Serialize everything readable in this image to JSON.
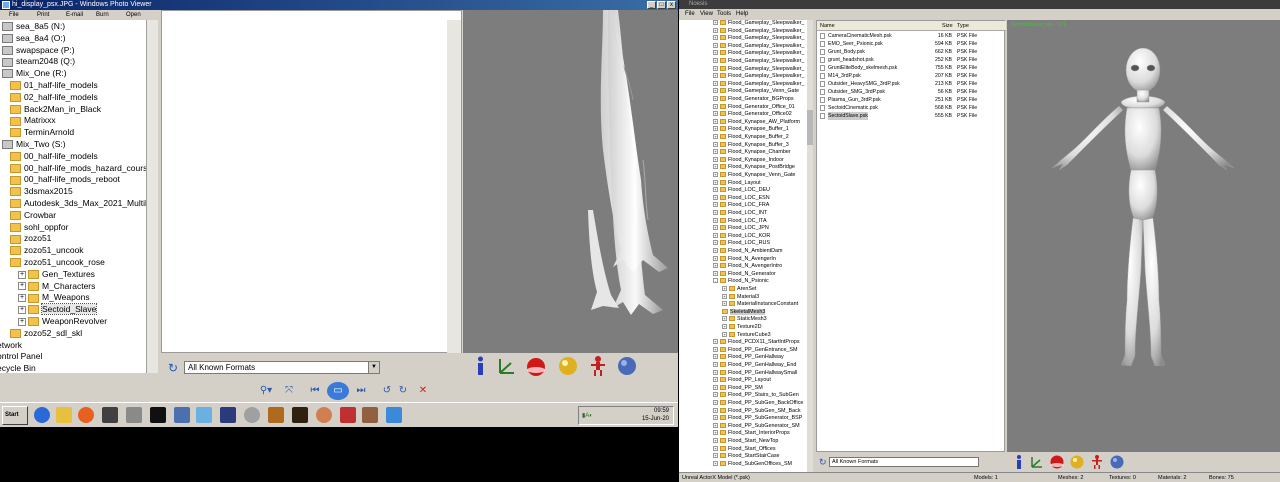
{
  "left_window": {
    "title": "hi_display_psx.JPG - Windows Photo Viewer",
    "menu": [
      "File",
      "Print",
      "E-mail",
      "Burn",
      "Open"
    ],
    "tree": [
      {
        "label": "sea_8a5 (N:)",
        "indent": 0,
        "type": "drive"
      },
      {
        "label": "sea_8a4 (O:)",
        "indent": 0,
        "type": "drive"
      },
      {
        "label": "swapspace (P:)",
        "indent": 0,
        "type": "drive"
      },
      {
        "label": "steam2048 (Q:)",
        "indent": 0,
        "type": "drive"
      },
      {
        "label": "Mix_One (R:)",
        "indent": 0,
        "type": "drive"
      },
      {
        "label": "01_half-life_models",
        "indent": 1,
        "type": "folder"
      },
      {
        "label": "02_half-life_models",
        "indent": 1,
        "type": "folder"
      },
      {
        "label": "Back2Man_in_Black",
        "indent": 1,
        "type": "folder"
      },
      {
        "label": "Matrixxx",
        "indent": 1,
        "type": "folder"
      },
      {
        "label": "TerminArnold",
        "indent": 1,
        "type": "folder"
      },
      {
        "label": "Mix_Two (S:)",
        "indent": 0,
        "type": "drive"
      },
      {
        "label": "00_half-life_models",
        "indent": 1,
        "type": "folder"
      },
      {
        "label": "00_half-life_mods_hazard_course",
        "indent": 1,
        "type": "folder"
      },
      {
        "label": "00_half-life_mods_reboot",
        "indent": 1,
        "type": "folder"
      },
      {
        "label": "3dsmax2015",
        "indent": 1,
        "type": "folder"
      },
      {
        "label": "Autodesk_3ds_Max_2021_Multilang",
        "indent": 1,
        "type": "folder"
      },
      {
        "label": "Crowbar",
        "indent": 1,
        "type": "folder"
      },
      {
        "label": "sohl_oppfor",
        "indent": 1,
        "type": "folder"
      },
      {
        "label": "zozo51",
        "indent": 1,
        "type": "folder"
      },
      {
        "label": "zozo51_uncook",
        "indent": 1,
        "type": "folder"
      },
      {
        "label": "zozo51_uncook_rose",
        "indent": 1,
        "type": "folder"
      },
      {
        "label": "Gen_Textures",
        "indent": 2,
        "type": "folder",
        "expandable": true
      },
      {
        "label": "M_Characters",
        "indent": 2,
        "type": "folder",
        "expandable": true
      },
      {
        "label": "M_Weapons",
        "indent": 2,
        "type": "folder",
        "expandable": true
      },
      {
        "label": "Sectoid_Slave",
        "indent": 2,
        "type": "folder",
        "expandable": true,
        "selected": true
      },
      {
        "label": "WeaponRevolver",
        "indent": 2,
        "type": "folder",
        "expandable": true
      },
      {
        "label": "zozo52_sdl_skl",
        "indent": 1,
        "type": "folder"
      },
      {
        "label": "etwork",
        "indent": -1,
        "type": "plain"
      },
      {
        "label": "ontrol Panel",
        "indent": -1,
        "type": "plain"
      },
      {
        "label": "ecycle Bin",
        "indent": -1,
        "type": "plain"
      }
    ],
    "filter": {
      "refresh_icon": "refresh-icon",
      "value": "All Known Formats"
    },
    "taskbar": {
      "start_label": "Start",
      "clock_time": "09:59",
      "clock_date": "15-Jun-20"
    }
  },
  "right_window": {
    "title": "Noesis",
    "menu": [
      "File",
      "View",
      "Tools",
      "Help"
    ],
    "packages": [
      {
        "label": "Flood_Gameplay_Sleepwalker_",
        "indent": 1,
        "expandable": true
      },
      {
        "label": "Flood_Gameplay_Sleepwalker_",
        "indent": 1,
        "expandable": true
      },
      {
        "label": "Flood_Gameplay_Sleepwalker_",
        "indent": 1,
        "expandable": true
      },
      {
        "label": "Flood_Gameplay_Sleepwalker_",
        "indent": 1,
        "expandable": true
      },
      {
        "label": "Flood_Gameplay_Sleepwalker_",
        "indent": 1,
        "expandable": true
      },
      {
        "label": "Flood_Gameplay_Sleepwalker_",
        "indent": 1,
        "expandable": true
      },
      {
        "label": "Flood_Gameplay_Sleepwalker_",
        "indent": 1,
        "expandable": true
      },
      {
        "label": "Flood_Gameplay_Sleepwalker_",
        "indent": 1,
        "expandable": true
      },
      {
        "label": "Flood_Gameplay_Sleepwalker_",
        "indent": 1,
        "expandable": true
      },
      {
        "label": "Flood_Gameplay_Venn_Gate",
        "indent": 1,
        "expandable": true
      },
      {
        "label": "Flood_Generator_BGProps",
        "indent": 1,
        "expandable": true
      },
      {
        "label": "Flood_Generator_Office_01",
        "indent": 1,
        "expandable": true
      },
      {
        "label": "Flood_Generator_Office02",
        "indent": 1,
        "expandable": true
      },
      {
        "label": "Flood_Kynapse_AW_Platform",
        "indent": 1,
        "expandable": true
      },
      {
        "label": "Flood_Kynapse_Buffer_1",
        "indent": 1,
        "expandable": true
      },
      {
        "label": "Flood_Kynapse_Buffer_2",
        "indent": 1,
        "expandable": true
      },
      {
        "label": "Flood_Kynapse_Buffer_3",
        "indent": 1,
        "expandable": true
      },
      {
        "label": "Flood_Kynapse_Chamber",
        "indent": 1,
        "expandable": true
      },
      {
        "label": "Flood_Kynapse_Indoor",
        "indent": 1,
        "expandable": true
      },
      {
        "label": "Flood_Kynapse_PostBridge",
        "indent": 1,
        "expandable": true
      },
      {
        "label": "Flood_Kynapse_Venn_Gate",
        "indent": 1,
        "expandable": true
      },
      {
        "label": "Flood_Layout",
        "indent": 1,
        "expandable": true
      },
      {
        "label": "Flood_LOC_DEU",
        "indent": 1,
        "expandable": true
      },
      {
        "label": "Flood_LOC_ESN",
        "indent": 1,
        "expandable": true
      },
      {
        "label": "Flood_LOC_FRA",
        "indent": 1,
        "expandable": true
      },
      {
        "label": "Flood_LOC_INT",
        "indent": 1,
        "expandable": true
      },
      {
        "label": "Flood_LOC_ITA",
        "indent": 1,
        "expandable": true
      },
      {
        "label": "Flood_LOC_JPN",
        "indent": 1,
        "expandable": true
      },
      {
        "label": "Flood_LOC_KOR",
        "indent": 1,
        "expandable": true
      },
      {
        "label": "Flood_LOC_RUS",
        "indent": 1,
        "expandable": true
      },
      {
        "label": "Flood_N_AmbientDam",
        "indent": 1,
        "expandable": true
      },
      {
        "label": "Flood_N_AvengerIn",
        "indent": 1,
        "expandable": true
      },
      {
        "label": "Flood_N_AvengerIntro",
        "indent": 1,
        "expandable": true
      },
      {
        "label": "Flood_N_Generator",
        "indent": 1,
        "expandable": true
      },
      {
        "label": "Flood_N_Psionic",
        "indent": 1,
        "expandable": true,
        "expanded": true
      },
      {
        "label": "ArenSet",
        "indent": 2,
        "expandable": true
      },
      {
        "label": "Material3",
        "indent": 2,
        "expandable": true
      },
      {
        "label": "MaterialInstanceConstant",
        "indent": 2,
        "expandable": true
      },
      {
        "label": "SkeletalMesh3",
        "indent": 2,
        "expandable": false,
        "selected": true
      },
      {
        "label": "StaticMesh3",
        "indent": 2,
        "expandable": true
      },
      {
        "label": "Texture2D",
        "indent": 2,
        "expandable": true
      },
      {
        "label": "TextureCube3",
        "indent": 2,
        "expandable": true
      },
      {
        "label": "Flood_PCDX11_StartIntProps",
        "indent": 1,
        "expandable": true
      },
      {
        "label": "Flood_PP_GenEntrance_SM",
        "indent": 1,
        "expandable": true
      },
      {
        "label": "Flood_PP_GenHallway",
        "indent": 1,
        "expandable": true
      },
      {
        "label": "Flood_PP_GenHallway_End",
        "indent": 1,
        "expandable": true
      },
      {
        "label": "Flood_PP_GenHallwaySmall",
        "indent": 1,
        "expandable": true
      },
      {
        "label": "Flood_PP_Layout",
        "indent": 1,
        "expandable": true
      },
      {
        "label": "Flood_PP_SM",
        "indent": 1,
        "expandable": true
      },
      {
        "label": "Flood_PP_Stairs_to_SubGen",
        "indent": 1,
        "expandable": true
      },
      {
        "label": "Flood_PP_SubGen_BackOffice",
        "indent": 1,
        "expandable": true
      },
      {
        "label": "Flood_PP_SubGen_SM_Back",
        "indent": 1,
        "expandable": true
      },
      {
        "label": "Flood_PP_SubGenerator_BSP",
        "indent": 1,
        "expandable": true
      },
      {
        "label": "Flood_PP_SubGenerator_SM",
        "indent": 1,
        "expandable": true
      },
      {
        "label": "Flood_Start_InteriorProps",
        "indent": 1,
        "expandable": true
      },
      {
        "label": "Flood_Start_NewTop",
        "indent": 1,
        "expandable": true
      },
      {
        "label": "Flood_Start_Offices",
        "indent": 1,
        "expandable": true
      },
      {
        "label": "Flood_StartStairCase",
        "indent": 1,
        "expandable": true
      },
      {
        "label": "Flood_SubGenOffices_SM",
        "indent": 1,
        "expandable": true
      }
    ],
    "resources": {
      "columns": [
        "Name",
        "Size",
        "Type"
      ],
      "rows": [
        {
          "name": "CameraCinematicMesh.psk",
          "size": "16 KB",
          "type": "PSK File"
        },
        {
          "name": "EMO_Seer_Psionic.psk",
          "size": "594 KB",
          "type": "PSK File"
        },
        {
          "name": "Grunt_Body.psk",
          "size": "662 KB",
          "type": "PSK File"
        },
        {
          "name": "grunt_headshot.psk",
          "size": "252 KB",
          "type": "PSK File"
        },
        {
          "name": "GruntEliteBody_skelmesh.psk",
          "size": "755 KB",
          "type": "PSK File"
        },
        {
          "name": "M14_3rdP.psk",
          "size": "207 KB",
          "type": "PSK File"
        },
        {
          "name": "Outsider_HeavySMG_3rdP.psk",
          "size": "213 KB",
          "type": "PSK File"
        },
        {
          "name": "Outsider_SMG_3rdP.psk",
          "size": "56 KB",
          "type": "PSK File"
        },
        {
          "name": "Plasma_Gun_3rdP.psk",
          "size": "251 KB",
          "type": "PSK File"
        },
        {
          "name": "SectoidCinematic.psk",
          "size": "568 KB",
          "type": "PSK File"
        },
        {
          "name": "SectoidSlave.psk",
          "size": "555 KB",
          "type": "PSK File",
          "selected": true
        }
      ]
    },
    "filter": {
      "value": "All Known Formats"
    },
    "viewport_label": "SectoidSlave.psk - 1/1",
    "status": {
      "format": "Unreal ActorX Model (*.psk)",
      "models": "Models: 1",
      "meshes": "Meshes: 2",
      "textures": "Textures: 0",
      "materials": "Materials: 2",
      "bones": "Bones: 75"
    }
  },
  "colors": {
    "viewport_bg": "#7d7d7d",
    "window_chrome": "#d4d0c8",
    "folder": "#f2c24a",
    "viewport_label": "#2fd02f"
  }
}
